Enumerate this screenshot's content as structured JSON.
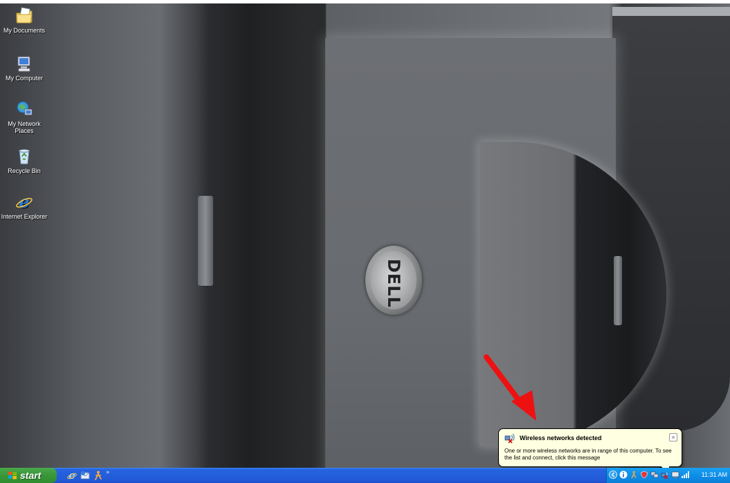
{
  "desktop": {
    "icons": [
      {
        "label": "My Documents",
        "icon": "my-documents-folder-icon"
      },
      {
        "label": "My Computer",
        "icon": "my-computer-icon"
      },
      {
        "label": "My Network Places",
        "icon": "network-places-icon"
      },
      {
        "label": "Recycle Bin",
        "icon": "recycle-bin-icon"
      },
      {
        "label": "Internet Explorer",
        "icon": "internet-explorer-icon"
      }
    ],
    "wallpaper_logo": "DELL"
  },
  "balloon": {
    "title": "Wireless networks detected",
    "message": "One or more wireless networks are in range of this computer. To see the list and connect, click this message",
    "close_symbol": "×",
    "icon": "wireless-network-icon"
  },
  "taskbar": {
    "start_label": "start",
    "quick_launch": [
      "internet-explorer-icon",
      "outlook-express-icon",
      "msn-messenger-icon"
    ],
    "more_symbol": "»",
    "tray_icons": [
      "show-hidden-icons-arrow",
      "info-icon",
      "messenger-tray-icon",
      "security-shield-icon",
      "network-icon",
      "wireless-icon",
      "display-icon",
      "signal-strength-icon"
    ],
    "clock": "11:31 AM"
  },
  "colors": {
    "taskbar_blue": "#245edb",
    "start_green": "#3c9a3c",
    "tray_blue": "#0d8ee8",
    "balloon_bg": "#ffffe1",
    "arrow_red": "#ee1111"
  }
}
